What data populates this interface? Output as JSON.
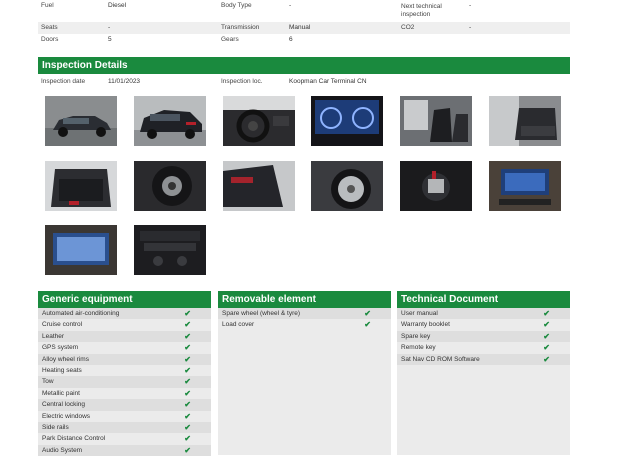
{
  "specs": {
    "rows": [
      {
        "l1": "Fuel",
        "v1": "Diesel",
        "l2": "Body Type",
        "v2": "-",
        "l3": "Next technical inspection",
        "v3": "-"
      },
      {
        "l1": "Seats",
        "v1": "-",
        "l2": "Transmission",
        "v2": "Manual",
        "l3": "CO2",
        "v3": "-"
      },
      {
        "l1": "Doors",
        "v1": "5",
        "l2": "Gears",
        "v2": "6",
        "l3": "",
        "v3": ""
      }
    ]
  },
  "inspection": {
    "title": "Inspection Details",
    "date_label": "Inspection date",
    "date_value": "11/01/2023",
    "loc_label": "Inspection loc.",
    "loc_value": "Koopman Car Terminal CN"
  },
  "photos": [
    {
      "icon": "car-front-photo"
    },
    {
      "icon": "car-rear-photo"
    },
    {
      "icon": "steering-wheel-photo"
    },
    {
      "icon": "instrument-cluster-photo"
    },
    {
      "icon": "front-seats-photo"
    },
    {
      "icon": "rear-seats-photo"
    },
    {
      "icon": "open-trunk-photo"
    },
    {
      "icon": "spare-wheel-photo"
    },
    {
      "icon": "tail-light-photo"
    },
    {
      "icon": "alloy-wheel-photo"
    },
    {
      "icon": "trunk-tools-photo"
    },
    {
      "icon": "infotainment-screen-photo"
    },
    {
      "icon": "navigation-screen-photo"
    },
    {
      "icon": "dashboard-console-photo"
    }
  ],
  "generic": {
    "title": "Generic equipment",
    "items": [
      "Automated air-conditioning",
      "Cruise control",
      "Leather",
      "GPS system",
      "Alloy wheel rims",
      "Heating seats",
      "Tow",
      "Metallic paint",
      "Central locking",
      "Electric windows",
      "Side rails",
      "Park Distance Control",
      "Audio System"
    ]
  },
  "removable": {
    "title": "Removable element",
    "items": [
      "Spare wheel (wheel & tyre)",
      "Load cover"
    ]
  },
  "technical": {
    "title": "Technical Document",
    "items": [
      "User manual",
      "Warranty booklet",
      "Spare key",
      "Remote key",
      "Sat Nav CD ROM Software"
    ]
  },
  "check_glyph": "✔",
  "colors": {
    "accent": "#1a8a3e",
    "panel": "#ebebeb"
  }
}
